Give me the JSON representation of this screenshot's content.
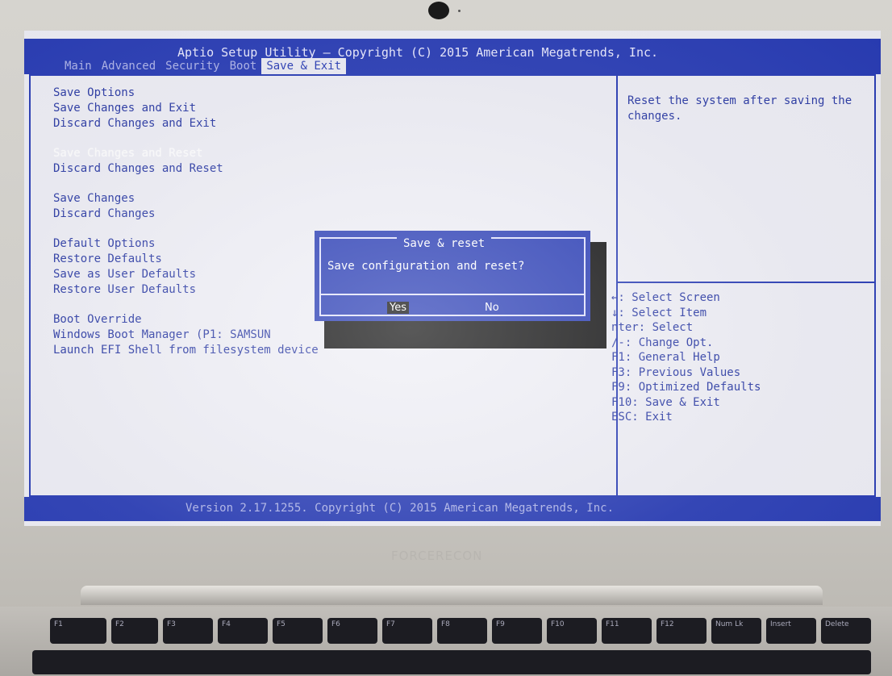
{
  "window": {
    "title": "Aptio Setup Utility – Copyright (C) 2015 American Megatrends, Inc."
  },
  "tabs": [
    {
      "label": "Main"
    },
    {
      "label": "Advanced"
    },
    {
      "label": "Security"
    },
    {
      "label": "Boot"
    },
    {
      "label": "Save & Exit",
      "active": true
    }
  ],
  "menu": {
    "save_options_header": "Save Options",
    "save_changes_and_exit": "Save Changes and Exit",
    "discard_changes_and_exit": "Discard Changes and Exit",
    "save_changes_and_reset": "Save Changes and Reset",
    "discard_changes_and_reset": "Discard Changes and Reset",
    "save_changes": "Save Changes",
    "discard_changes": "Discard Changes",
    "default_options_header": "Default Options",
    "restore_defaults": "Restore Defaults",
    "save_as_user_defaults": "Save as User Defaults",
    "restore_user_defaults": "Restore User Defaults",
    "boot_override_header": "Boot Override",
    "windows_boot_manager": "Windows Boot Manager (P1: SAMSUN",
    "launch_efi_shell": "Launch EFI Shell from filesystem device"
  },
  "help": {
    "text": "Reset the system after saving the changes."
  },
  "keys": [
    "←: Select Screen",
    "↓: Select Item",
    "nter: Select",
    "/-: Change Opt.",
    "F1: General Help",
    "F3: Previous Values",
    "F9: Optimized Defaults",
    "F10: Save & Exit",
    "ESC: Exit"
  ],
  "dialog": {
    "title": "Save & reset",
    "message": "Save configuration and reset?",
    "yes_label": "Yes",
    "no_label": "No"
  },
  "footer": {
    "text": "Version 2.17.1255. Copyright (C) 2015 American Megatrends, Inc."
  },
  "laptop": {
    "brand": "FORCERECON"
  },
  "keyboard_keys": [
    "F1",
    "F2",
    "F3",
    "F4",
    "F5",
    "F6",
    "F7",
    "F8",
    "F9",
    "F10",
    "F11",
    "F12",
    "Num Lk",
    "Insert",
    "Delete"
  ],
  "colors": {
    "bios_blue": "#1a2fb0",
    "bios_bg": "#eeeef5",
    "text_blue": "#1b2c9e"
  }
}
